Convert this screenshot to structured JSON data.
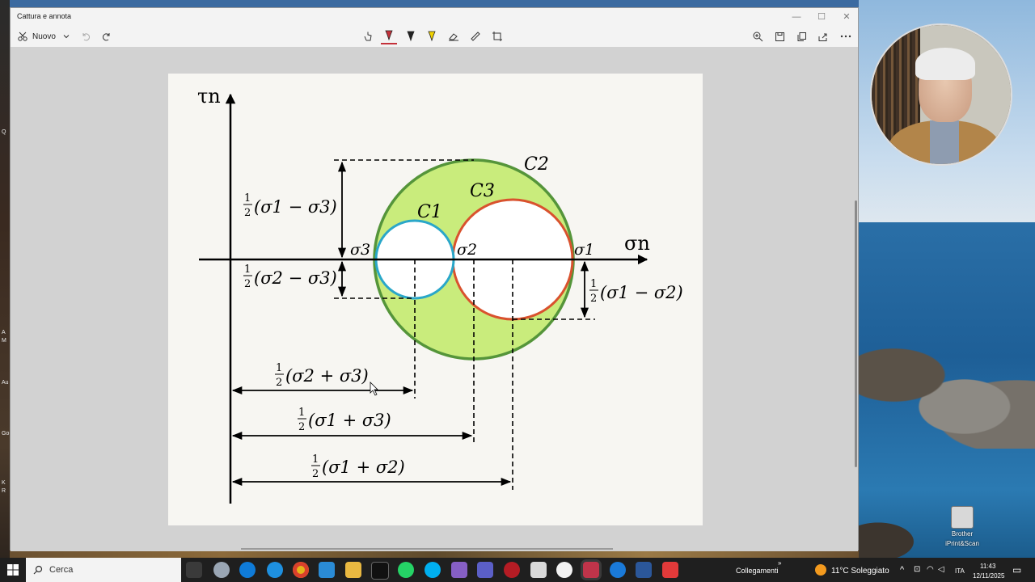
{
  "window": {
    "title": "Cattura e annota",
    "new_label": "Nuovo",
    "minimize": "—",
    "maximize": "☐",
    "close": "✕"
  },
  "figure": {
    "axis_y": "τn",
    "axis_x": "σn",
    "c1": "C1",
    "c2": "C2",
    "c3": "C3",
    "sigma1": "σ1",
    "sigma2": "σ2",
    "sigma3": "σ3",
    "half": "1",
    "two": "2",
    "r2_text": "(σ1 − σ3)",
    "r1_text": "(σ2 − σ3)",
    "r3_text": "(σ1 − σ2)",
    "c23_text": "(σ2 + σ3)",
    "c13_text": "(σ1 + σ3)",
    "c12_text": "(σ1 + σ2)",
    "colors": {
      "c1": "#2aa7c9",
      "c2": "#55953a",
      "c2_fill": "#c9ec7c",
      "c3": "#d9522e"
    }
  },
  "desktop": {
    "icon_label_1": "Brother",
    "icon_label_2": "iPrint&Scan",
    "frag_q": "Q",
    "frag_a": "A",
    "frag_m": "M",
    "frag_au": "Au",
    "frag_go": "Go",
    "frag_k": "K",
    "frag_r": "R"
  },
  "taskbar": {
    "search_label": "Cerca",
    "links_label": "Collegamenti",
    "weather": "11°C Soleggiato",
    "lang": "ITA",
    "time": "11:43",
    "date": "12/11/2025"
  }
}
